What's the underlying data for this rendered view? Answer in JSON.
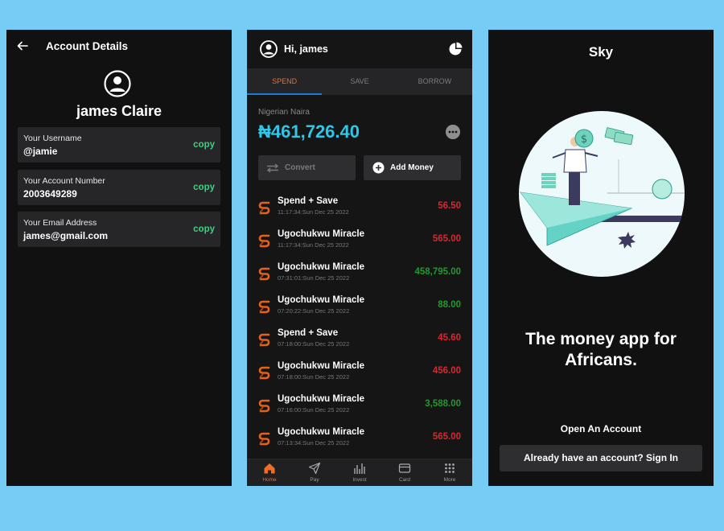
{
  "account_details": {
    "title": "Account Details",
    "name": "james Claire",
    "cards": [
      {
        "label": "Your Username",
        "value": "@jamie",
        "action": "copy"
      },
      {
        "label": "Your Account Number",
        "value": "2003649289",
        "action": "copy"
      },
      {
        "label": "Your Email Address",
        "value": "james@gmail.com",
        "action": "copy"
      }
    ]
  },
  "wallet": {
    "greeting": "Hi, james",
    "tabs": [
      "SPEND",
      "SAVE",
      "BORROW"
    ],
    "currency_label": "Nigerian Naira",
    "balance": "₦461,726.40",
    "convert_label": "Convert",
    "add_money_label": "Add Money",
    "transactions": [
      {
        "name": "Spend + Save",
        "time": "11:17:34:Sun Dec 25 2022",
        "amount": "56.50",
        "color": "#e0242c"
      },
      {
        "name": "Ugochukwu Miracle",
        "time": "11:17:34:Sun Dec 25 2022",
        "amount": "565.00",
        "color": "#e0242c"
      },
      {
        "name": "Ugochukwu Miracle",
        "time": "07:31:01:Sun Dec 25 2022",
        "amount": "458,795.00",
        "color": "#1f9a2b"
      },
      {
        "name": "Ugochukwu Miracle",
        "time": "07:20:22:Sun Dec 25 2022",
        "amount": "88.00",
        "color": "#1f9a2b"
      },
      {
        "name": "Spend + Save",
        "time": "07:18:00:Sun Dec 25 2022",
        "amount": "45.60",
        "color": "#e0242c"
      },
      {
        "name": "Ugochukwu Miracle",
        "time": "07:18:00:Sun Dec 25 2022",
        "amount": "456.00",
        "color": "#e0242c"
      },
      {
        "name": "Ugochukwu Miracle",
        "time": "07:16:00:Sun Dec 25 2022",
        "amount": "3,588.00",
        "color": "#1f9a2b"
      },
      {
        "name": "Ugochukwu Miracle",
        "time": "07:13:34:Sun Dec 25 2022",
        "amount": "565.00",
        "color": "#e0242c"
      }
    ],
    "nav": [
      {
        "label": "Home",
        "icon": "home-icon",
        "active": true
      },
      {
        "label": "Pay",
        "icon": "send-icon",
        "active": false
      },
      {
        "label": "Invest",
        "icon": "bar-chart-icon",
        "active": false
      },
      {
        "label": "Card",
        "icon": "card-icon",
        "active": false
      },
      {
        "label": "More",
        "icon": "grid-icon",
        "active": false
      }
    ]
  },
  "welcome": {
    "app_name": "Sky",
    "headline_line1": "The money app for",
    "headline_line2": "Africans.",
    "open_account": "Open An Account",
    "sign_in": "Already have an account? Sign In"
  },
  "colors": {
    "background": "#76ccf5",
    "screen": "#111112",
    "accent_orange": "#f26d22",
    "balance_cyan": "#2ec7e8",
    "copy_green": "#35d47c",
    "credit_green": "#1f9a2b",
    "debit_red": "#e0242c"
  }
}
